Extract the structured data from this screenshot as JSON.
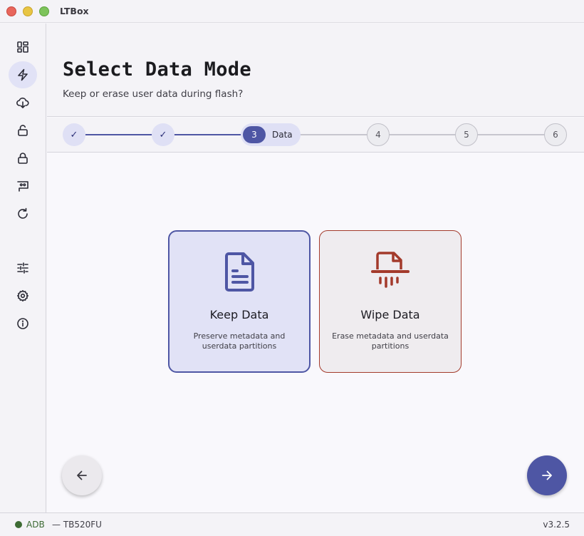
{
  "window": {
    "title": "LTBox"
  },
  "sidebar": {
    "items": [
      {
        "icon": "dashboard-icon"
      },
      {
        "icon": "flash-icon",
        "active": true
      },
      {
        "icon": "download-icon"
      },
      {
        "icon": "unlock-icon"
      },
      {
        "icon": "lock-icon"
      },
      {
        "icon": "device-icon"
      },
      {
        "icon": "refresh-icon"
      },
      {
        "icon": "sliders-icon"
      },
      {
        "icon": "gear-icon"
      },
      {
        "icon": "info-icon"
      }
    ]
  },
  "header": {
    "title": "Select Data Mode",
    "subtitle": "Keep or erase user data during flash?"
  },
  "stepper": {
    "steps": [
      {
        "label": "✓",
        "state": "done"
      },
      {
        "label": "✓",
        "state": "done"
      },
      {
        "label": "3",
        "name": "Data",
        "state": "active"
      },
      {
        "label": "4",
        "state": "todo"
      },
      {
        "label": "5",
        "state": "todo"
      },
      {
        "label": "6",
        "state": "todo"
      }
    ]
  },
  "options": {
    "keep": {
      "title": "Keep Data",
      "description": "Preserve metadata and userdata partitions",
      "selected": true,
      "icon": "document-icon",
      "color": "#4e56a4"
    },
    "wipe": {
      "title": "Wipe Data",
      "description": "Erase metadata and userdata partitions",
      "selected": false,
      "icon": "shredder-icon",
      "color": "#a33a2b"
    }
  },
  "navigation": {
    "back_icon": "arrow-left-icon",
    "next_icon": "arrow-right-icon"
  },
  "status": {
    "connection": "ADB",
    "device": "— TB520FU",
    "version": "v3.2.5",
    "connection_color": "#3d6b34"
  }
}
